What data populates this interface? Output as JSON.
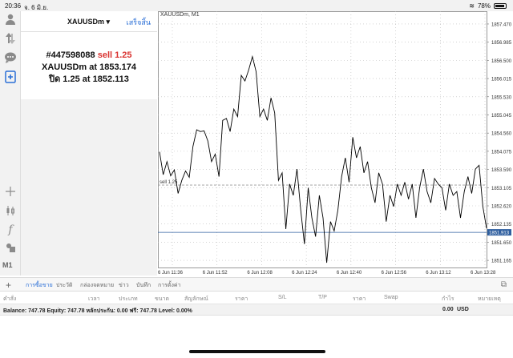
{
  "status": {
    "time": "20:36",
    "date": "จ. 6 มิ.ย.",
    "battery": "78%"
  },
  "toolbar": {
    "icons": [
      "user-icon",
      "trade-arrows-icon",
      "chat-icon",
      "new-order-icon"
    ],
    "tools": [
      "crosshair-icon",
      "candles-icon",
      "indicator-f-icon",
      "objects-icon"
    ],
    "timeframe": "M1"
  },
  "order_panel": {
    "symbol": "XAUUSDm",
    "done_label": "เสร็จสิ้น",
    "ticket_line": "#447598088",
    "action": "sell 1.25",
    "line2_prefix": "XAUUSDm at",
    "line2_price": "1853.174",
    "line3_prefix": "ปิด 1.25 at",
    "line3_price": "1852.113"
  },
  "chart_header": {
    "title": "XAUUSDm, M1"
  },
  "chart_data": {
    "type": "line",
    "title": "XAUUSDm, M1",
    "x_labels": [
      "6 Jun 11:36",
      "6 Jun 11:52",
      "6 Jun 12:08",
      "6 Jun 12:24",
      "6 Jun 12:40",
      "6 Jun 12:56",
      "6 Jun 13:12",
      "6 Jun 13:28"
    ],
    "y_ticks": [
      "1857.470",
      "1856.985",
      "1856.500",
      "1856.015",
      "1855.530",
      "1855.045",
      "1854.560",
      "1854.075",
      "1853.590",
      "1853.105",
      "1852.620",
      "1852.135",
      "1851.650",
      "1851.165"
    ],
    "ylim": [
      1850.975,
      1857.64
    ],
    "values": [
      1854.06,
      1853.45,
      1853.8,
      1853.42,
      1853.58,
      1852.95,
      1853.3,
      1853.55,
      1853.38,
      1854.2,
      1854.65,
      1854.6,
      1854.62,
      1854.35,
      1853.8,
      1854.0,
      1853.4,
      1854.9,
      1854.95,
      1854.6,
      1855.2,
      1855.0,
      1856.1,
      1855.95,
      1856.25,
      1856.6,
      1856.2,
      1855.0,
      1855.2,
      1854.9,
      1855.5,
      1855.1,
      1853.3,
      1853.5,
      1852.0,
      1853.2,
      1852.9,
      1853.6,
      1852.5,
      1851.6,
      1853.1,
      1852.3,
      1851.8,
      1852.9,
      1852.3,
      1851.1,
      1852.2,
      1851.95,
      1852.5,
      1853.4,
      1853.9,
      1853.25,
      1854.45,
      1853.9,
      1854.2,
      1853.5,
      1853.8,
      1853.1,
      1852.7,
      1853.5,
      1853.2,
      1852.2,
      1852.9,
      1852.6,
      1853.2,
      1852.9,
      1853.25,
      1852.8,
      1853.2,
      1852.3,
      1853.1,
      1853.6,
      1853.0,
      1852.7,
      1853.35,
      1853.2,
      1853.1,
      1852.5,
      1853.2,
      1852.9,
      1853.0,
      1852.3,
      1853.0,
      1853.4,
      1852.95,
      1853.6,
      1853.7,
      1852.6,
      1852.02
    ],
    "price_line": {
      "label": "sell 1.25",
      "value": 1853.174
    },
    "bid_line": {
      "label": "1851.913",
      "value": 1851.913
    },
    "colors": {
      "line": "#000000",
      "grid": "#bbbbbb",
      "bid": "#2f5f9f"
    }
  },
  "tabs": {
    "items": [
      "การซื้อขาย",
      "ประวัติ",
      "กล่องจดหมาย",
      "ข่าว",
      "บันทึก",
      "การตั้งค่า"
    ],
    "active": 0
  },
  "columns": [
    "คำสั่ง",
    "เวลา",
    "ประเภท",
    "ขนาด",
    "สัญลักษณ์",
    "ราคา",
    "S/L",
    "T/P",
    "ราคา",
    "Swap",
    "กำไร",
    "หมายเหตุ"
  ],
  "account": {
    "summary": "Balance: 747.78 Equity: 747.78 หลักประกัน: 0.00 ฟรี: 747.78 Level: 0.00%",
    "profit": "0.00",
    "currency": "USD"
  }
}
